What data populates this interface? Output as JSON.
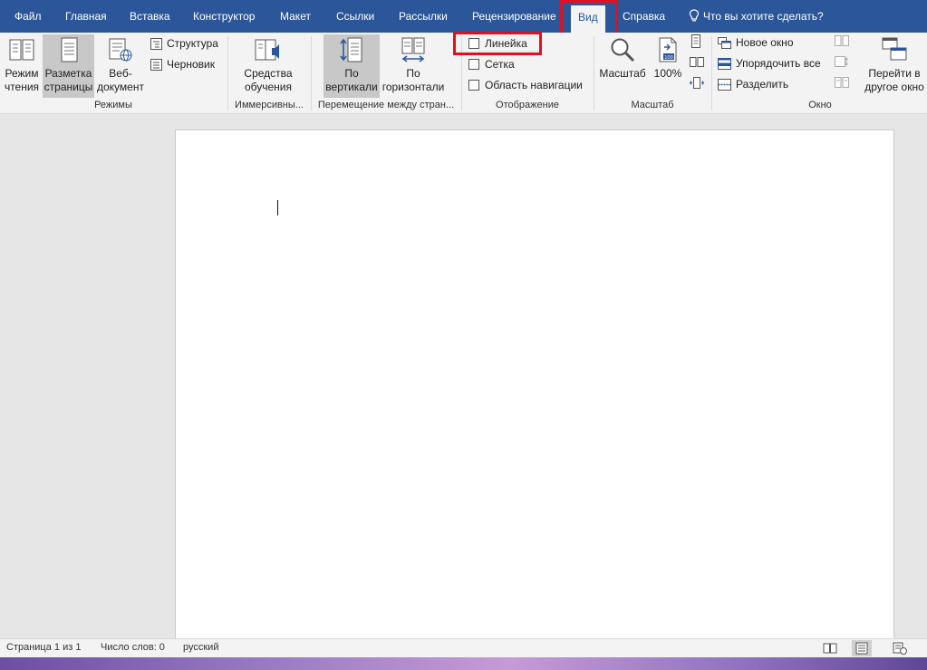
{
  "tabs": [
    {
      "id": "file",
      "label": "Файл"
    },
    {
      "id": "home",
      "label": "Главная"
    },
    {
      "id": "insert",
      "label": "Вставка"
    },
    {
      "id": "design",
      "label": "Конструктор"
    },
    {
      "id": "layout",
      "label": "Макет"
    },
    {
      "id": "references",
      "label": "Ссылки"
    },
    {
      "id": "mailings",
      "label": "Рассылки"
    },
    {
      "id": "review",
      "label": "Рецензирование"
    },
    {
      "id": "view",
      "label": "Вид",
      "active": true
    },
    {
      "id": "help",
      "label": "Справка"
    }
  ],
  "tell_me": "Что вы хотите сделать?",
  "ribbon": {
    "views": {
      "label": "Режимы",
      "read_mode": "Режим чтения",
      "read_mode_l1": "Режим",
      "read_mode_l2": "чтения",
      "print_layout_l1": "Разметка",
      "print_layout_l2": "страницы",
      "web_layout_l1": "Веб-",
      "web_layout_l2": "документ",
      "outline": "Структура",
      "draft": "Черновик"
    },
    "immersive": {
      "label": "Иммерсивны...",
      "learning_l1": "Средства",
      "learning_l2": "обучения"
    },
    "page_movement": {
      "label": "Перемещение между стран...",
      "vertical_l1": "По",
      "vertical_l2": "вертикали",
      "side_l1": "По",
      "side_l2": "горизонтали"
    },
    "show": {
      "label": "Отображение",
      "ruler": "Линейка",
      "ruler_checked": false,
      "gridlines": "Сетка",
      "gridlines_checked": false,
      "nav_pane": "Область навигации",
      "nav_pane_checked": false
    },
    "zoom": {
      "label": "Масштаб",
      "zoom": "Масштаб",
      "percent": "100%",
      "percent_badge": "100"
    },
    "window": {
      "label": "Окно",
      "new_window": "Новое окно",
      "arrange_all": "Упорядочить все",
      "split": "Разделить",
      "switch_l1": "Перейти в",
      "switch_l2": "другое окно"
    }
  },
  "status": {
    "page": "Страница 1 из 1",
    "words": "Число слов: 0",
    "language": "русский"
  },
  "highlight_color": "#e01020",
  "accent_color": "#2b579a"
}
